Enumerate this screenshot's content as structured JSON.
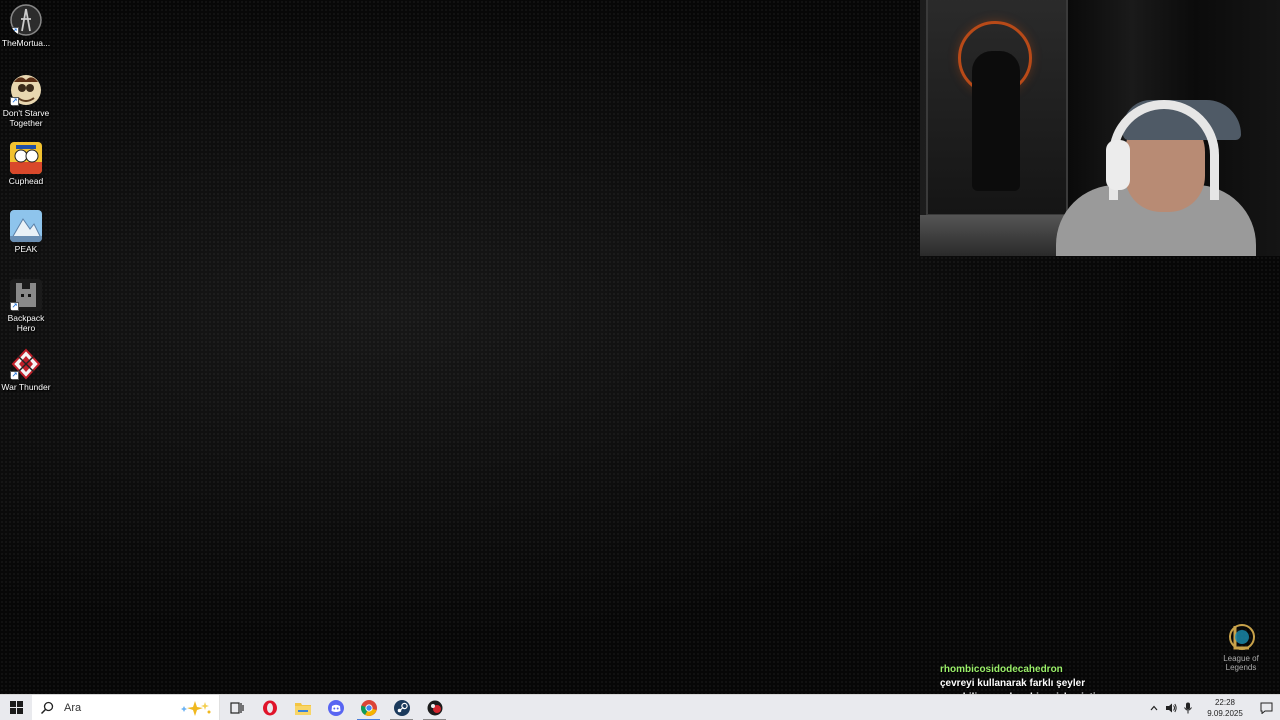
{
  "desktop": {
    "icons": [
      {
        "label": "TheMortua...",
        "icon": "the-mortuary-assistant-icon"
      },
      {
        "label": "Don't Starve Together",
        "icon": "dont-starve-together-icon"
      },
      {
        "label": "Cuphead",
        "icon": "cuphead-icon"
      },
      {
        "label": "PEAK",
        "icon": "peak-icon"
      },
      {
        "label": "Backpack Hero",
        "icon": "backpack-hero-icon"
      },
      {
        "label": "War Thunder",
        "icon": "war-thunder-icon"
      }
    ],
    "corner_icon": {
      "label": "League of Legends",
      "icon": "league-of-legends-icon"
    }
  },
  "chat": {
    "username": "rhombicosidodecahedron",
    "message": "çevreyi kullanarak farklı şeyler yapabiliyosun ben biraz izlemiştim",
    "username_color": "#9bf06a"
  },
  "taskbar": {
    "search_placeholder": "Ara",
    "apps": [
      {
        "name": "task-view-icon"
      },
      {
        "name": "opera-icon"
      },
      {
        "name": "file-explorer-icon"
      },
      {
        "name": "discord-icon"
      },
      {
        "name": "chrome-icon"
      },
      {
        "name": "steam-icon"
      },
      {
        "name": "game-app-icon"
      }
    ],
    "clock": {
      "time": "22:28",
      "date": "9.09.2025"
    },
    "accent": "#4a7ed9"
  }
}
